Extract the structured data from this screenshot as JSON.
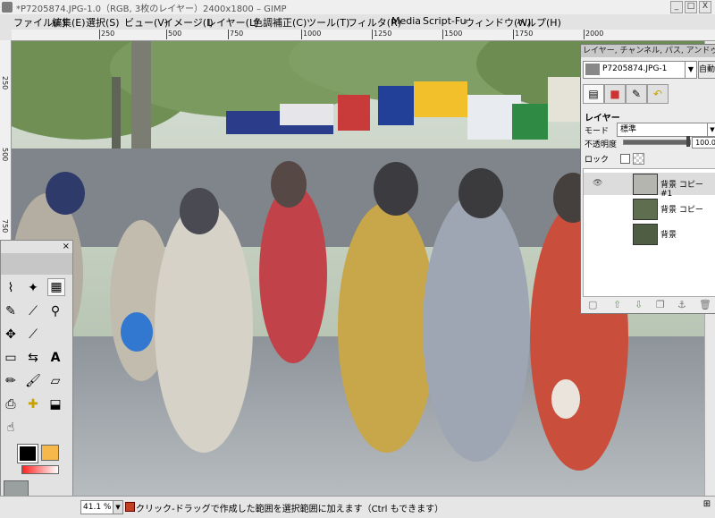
{
  "window": {
    "title": "*P7205874.JPG-1.0（RGB, 3枚のレイヤー）2400x1800 – GIMP",
    "minimize": "_",
    "maximize": "□",
    "close": "X"
  },
  "menu": [
    "ファイル(F)",
    "編集(E)",
    "選択(S)",
    "ビュー(V)",
    "イメージ(I)",
    "レイヤー(L)",
    "色調補正(C)",
    "ツール(T)",
    "フィルタ(R)",
    "Media",
    "Script-Fu",
    "ウィンドウ(W)",
    "ヘルプ(H)"
  ],
  "ruler": {
    "top_ticks": [
      "250",
      "500",
      "750",
      "1000",
      "1250",
      "1500",
      "1750",
      "2000"
    ],
    "left_ticks": [
      "250",
      "500",
      "750",
      "1000",
      "1250",
      "1500"
    ]
  },
  "toolbox": {
    "close": "×",
    "tools": [
      "lasso",
      "fuzzy-select",
      "select-by-color",
      "paths",
      "color-picker",
      "zoom",
      "move",
      "measure",
      "transform",
      "flip",
      "crop",
      "text",
      "pencil",
      "paintbrush",
      "eraser",
      "airbrush",
      "clone",
      "heal",
      "smudge",
      "dodge-burn",
      "bucket-fill"
    ]
  },
  "dock": {
    "title": "レイヤー, チャンネル, パス, アンドゥ",
    "image_select": "P7205874.JPG-1",
    "auto_button": "自動",
    "section": "レイヤー",
    "mode_label": "モード",
    "mode_value": "標準",
    "opacity_label": "不透明度",
    "opacity_value": "100.0",
    "opacity_fraction": 1.0,
    "lock_label": "ロック",
    "layers": [
      {
        "name": "背景 コピー#1",
        "visible": true,
        "selected": true
      },
      {
        "name": "背景 コピー",
        "visible": false,
        "selected": false
      },
      {
        "name": "背景",
        "visible": false,
        "selected": false
      }
    ]
  },
  "status": {
    "zoom": "41.1 %",
    "hint": "クリック-ドラッグで作成した範囲を選択範囲に加えます（Ctrl もできます）"
  }
}
